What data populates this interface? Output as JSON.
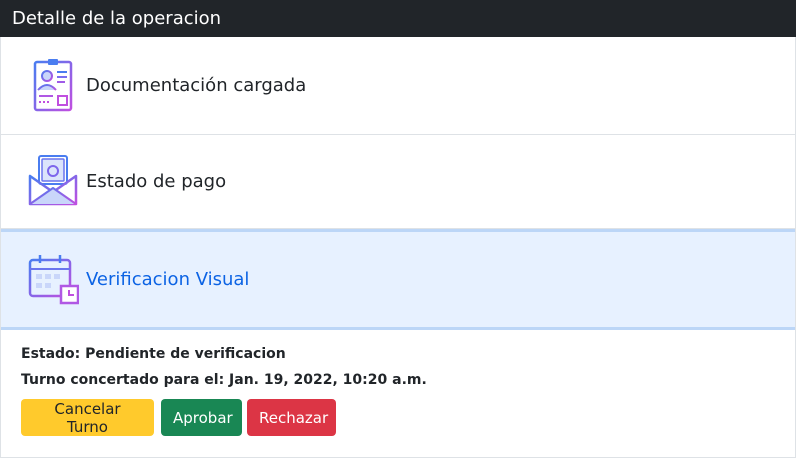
{
  "header": {
    "title": "Detalle de la operacion"
  },
  "accordion": {
    "items": [
      {
        "label": "Documentación cargada",
        "icon": "id-card-icon"
      },
      {
        "label": "Estado de pago",
        "icon": "money-envelope-icon"
      },
      {
        "label": "Verificacion Visual",
        "icon": "calendar-clock-icon",
        "active": true
      }
    ],
    "body": {
      "estado": "Estado: Pendiente de verificacion",
      "turno": "Turno concertado para el: Jan. 19, 2022, 10:20 a.m.",
      "buttons": {
        "cancel": "Cancelar Turno",
        "approve": "Aprobar",
        "reject": "Rechazar"
      }
    }
  },
  "colors": {
    "header_bg": "#212529",
    "active_bg": "#e7f1ff",
    "active_text": "#0c63e4",
    "warning": "#ffca2c",
    "success": "#198754",
    "danger": "#dc3545"
  }
}
